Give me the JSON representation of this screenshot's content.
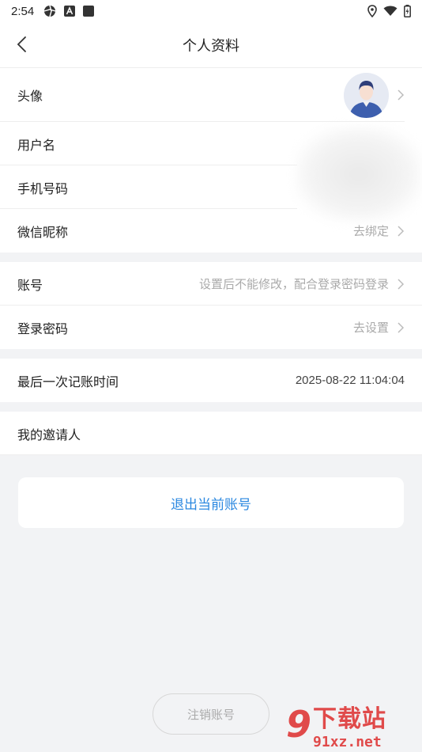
{
  "status_bar": {
    "time": "2:54"
  },
  "header": {
    "title": "个人资料"
  },
  "profile": {
    "avatar_label": "头像",
    "username_label": "用户名",
    "phone_label": "手机号码",
    "wechat_label": "微信昵称",
    "wechat_value": "去绑定"
  },
  "account": {
    "account_label": "账号",
    "account_value": "设置后不能修改，配合登录密码登录",
    "password_label": "登录密码",
    "password_value": "去设置"
  },
  "record": {
    "last_record_label": "最后一次记账时间",
    "last_record_value": "2025-08-22 11:04:04"
  },
  "invite": {
    "inviter_label": "我的邀请人"
  },
  "actions": {
    "logout_label": "退出当前账号",
    "cancel_account_label": "注销账号"
  },
  "watermark": {
    "num": "9",
    "big": "下载站",
    "small": "91xz.net"
  },
  "colors": {
    "accent": "#2b88e0",
    "background": "#f2f3f5",
    "watermark": "#e04a4a"
  }
}
